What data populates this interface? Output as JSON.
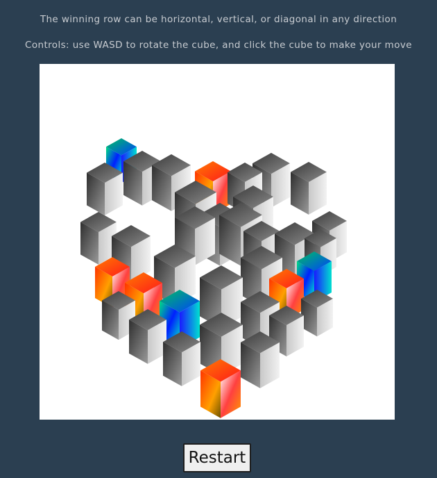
{
  "instructions": {
    "win_rule": "The winning row can be horizontal, vertical, or diagonal in any direction",
    "controls": "Controls: use WASD to rotate the cube, and click the cube to make your move"
  },
  "board": {
    "grid_size": 4,
    "background": "#ffffff",
    "empty_cell_color": "gray-gradient",
    "player_colors": {
      "player_1": "warm-gradient",
      "player_2": "cool-gradient"
    }
  },
  "controls": {
    "restart_label": "Restart"
  },
  "theme": {
    "page_background": "#2b3f51",
    "text_color": "#c8ccd1"
  }
}
